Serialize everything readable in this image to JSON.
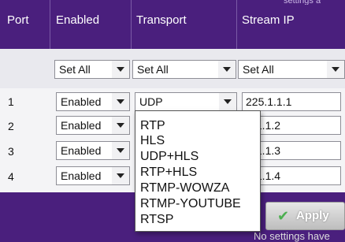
{
  "header": {
    "port": "Port",
    "enabled": "Enabled",
    "transport": "Transport",
    "stream_ip": "Stream IP",
    "top_fragment": "settings a"
  },
  "set_all": {
    "enabled": "Set All",
    "transport": "Set All",
    "stream_ip": "Set All"
  },
  "rows": [
    {
      "port": "1",
      "enabled": "Enabled",
      "transport": "UDP",
      "ip": "225.1.1.1"
    },
    {
      "port": "2",
      "enabled": "Enabled",
      "ip": ".1.1.2"
    },
    {
      "port": "3",
      "enabled": "Enabled",
      "ip": ".1.1.3"
    },
    {
      "port": "4",
      "enabled": "Enabled",
      "ip": ".1.1.4"
    }
  ],
  "transport_dropdown": {
    "options": [
      "RTP",
      "HLS",
      "UDP+HLS",
      "RTP+HLS",
      "RTMP-WOWZA",
      "RTMP-YOUTUBE",
      "RTSP"
    ]
  },
  "footer": {
    "apply": "Apply",
    "note": "No settings have"
  },
  "colors": {
    "header_bg": "#4a1f7d",
    "apply_check": "#4caf50"
  }
}
